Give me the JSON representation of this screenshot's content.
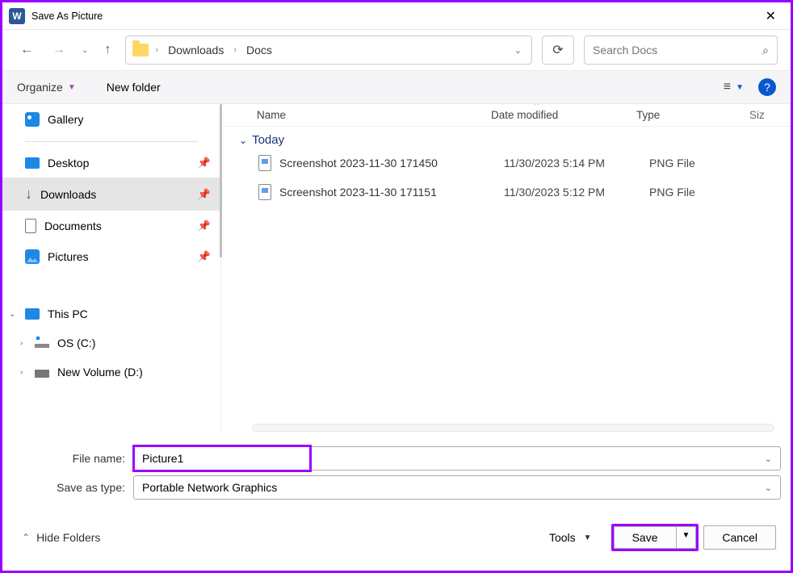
{
  "window": {
    "title": "Save As Picture"
  },
  "nav": {
    "crumbs": [
      "Downloads",
      "Docs"
    ],
    "search_placeholder": "Search Docs"
  },
  "toolbar": {
    "organize": "Organize",
    "new_folder": "New folder"
  },
  "sidebar": {
    "gallery": "Gallery",
    "quick": [
      {
        "label": "Desktop"
      },
      {
        "label": "Downloads",
        "selected": true
      },
      {
        "label": "Documents"
      },
      {
        "label": "Pictures"
      }
    ],
    "thispc": "This PC",
    "drives": [
      {
        "label": "OS (C:)"
      },
      {
        "label": "New Volume (D:)"
      }
    ]
  },
  "columns": {
    "name": "Name",
    "date": "Date modified",
    "type": "Type",
    "size": "Siz"
  },
  "group": "Today",
  "files": [
    {
      "name": "Screenshot 2023-11-30 171450",
      "date": "11/30/2023 5:14 PM",
      "type": "PNG File"
    },
    {
      "name": "Screenshot 2023-11-30 171151",
      "date": "11/30/2023 5:12 PM",
      "type": "PNG File"
    }
  ],
  "form": {
    "filename_label": "File name:",
    "filename_value": "Picture1",
    "saveastype_label": "Save as type:",
    "saveastype_value": "Portable Network Graphics"
  },
  "footer": {
    "hide_folders": "Hide Folders",
    "tools": "Tools",
    "save": "Save",
    "cancel": "Cancel"
  }
}
